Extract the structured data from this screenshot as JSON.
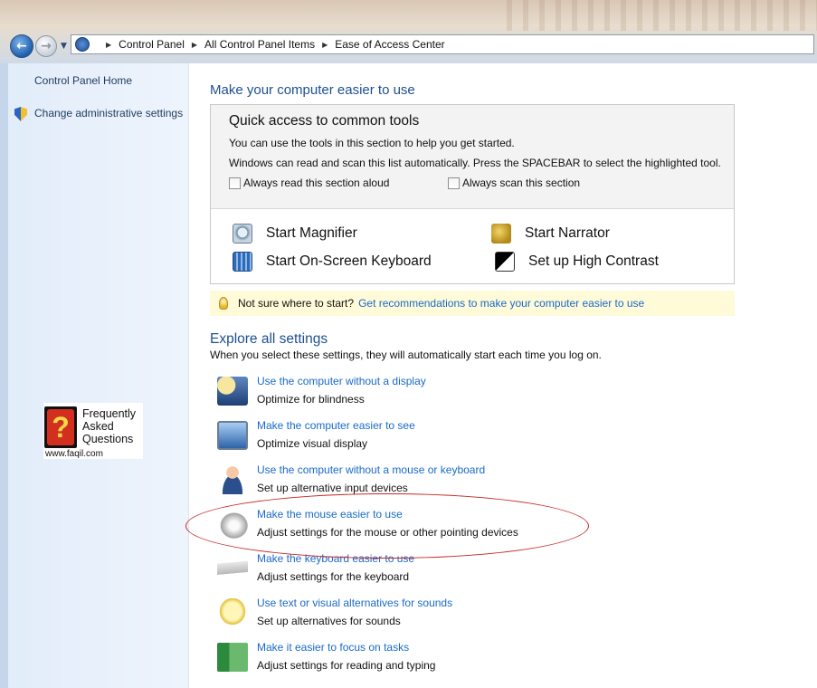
{
  "breadcrumb": [
    "Control Panel",
    "All Control Panel Items",
    "Ease of Access Center"
  ],
  "left_pane": {
    "home_link": "Control Panel Home",
    "admin_link": "Change administrative settings",
    "faq": {
      "line1": "Frequently",
      "line2": "Asked",
      "line3": "Questions",
      "url": "www.faqil.com",
      "badge_glyph": "?"
    }
  },
  "main": {
    "title": "Make your computer easier to use",
    "quick_access": {
      "title": "Quick access to common tools",
      "desc1": "You can use the tools in this section to help you get started.",
      "desc2": "Windows can read and scan this list automatically.  Press the SPACEBAR to select the highlighted tool.",
      "check_read": "Always read this section aloud",
      "check_scan": "Always scan this section",
      "tools": {
        "magnifier": "Start Magnifier",
        "narrator": "Start Narrator",
        "keyboard": "Start On-Screen Keyboard",
        "contrast": "Set up High Contrast"
      }
    },
    "tip": {
      "text": "Not sure where to start?",
      "link": "Get recommendations to make your computer easier to use"
    },
    "explore": {
      "title": "Explore all settings",
      "desc": "When you select these settings, they will automatically start each time you log on.",
      "items": [
        {
          "link": "Use the computer without a display",
          "sub": "Optimize for blindness",
          "icon": "display-icon"
        },
        {
          "link": "Make the computer easier to see",
          "sub": "Optimize visual display",
          "icon": "magnify-screen-icon"
        },
        {
          "link": "Use the computer without a mouse or keyboard",
          "sub": "Set up alternative input devices",
          "icon": "person-icon"
        },
        {
          "link": "Make the mouse easier to use",
          "sub": "Adjust settings for the mouse or other pointing devices",
          "icon": "mouse-icon"
        },
        {
          "link": "Make the keyboard easier to use",
          "sub": "Adjust settings for the keyboard",
          "icon": "keyboard-icon"
        },
        {
          "link": "Use text or visual alternatives for sounds",
          "sub": "Set up alternatives for sounds",
          "icon": "speech-bubble-icon"
        },
        {
          "link": "Make it easier to focus on tasks",
          "sub": "Adjust settings for reading and typing",
          "icon": "focus-window-icon"
        }
      ]
    }
  },
  "colors": {
    "link": "#1a6ac8",
    "heading": "#1e4f91",
    "tip_bg": "#fffbd9",
    "highlight_ellipse": "#c62828"
  }
}
